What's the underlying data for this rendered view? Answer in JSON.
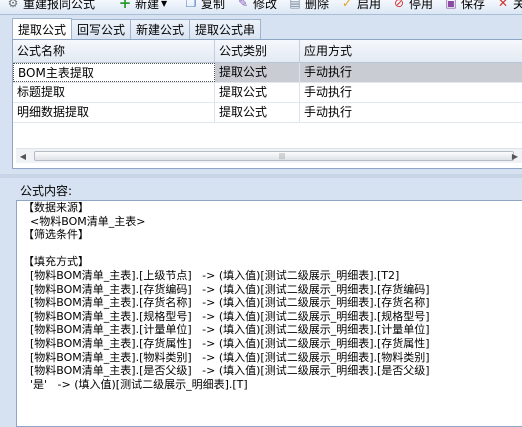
{
  "toolbar": {
    "items": [
      {
        "label": "重建报同公式",
        "icon": "gear-icon"
      },
      {
        "label": "新建",
        "icon": "plus-icon"
      },
      {
        "label": "复制",
        "icon": "copy-icon"
      },
      {
        "label": "修改",
        "icon": "edit-icon"
      },
      {
        "label": "删除",
        "icon": "delete-icon"
      },
      {
        "label": "启用",
        "icon": "check-icon"
      },
      {
        "label": "停用",
        "icon": "stop-icon"
      },
      {
        "label": "保存",
        "icon": "save-icon"
      },
      {
        "label": "关",
        "icon": "close-icon"
      }
    ]
  },
  "tabs": [
    {
      "label": "提取公式",
      "active": true
    },
    {
      "label": "回写公式",
      "active": false
    },
    {
      "label": "新建公式",
      "active": false
    },
    {
      "label": "提取公式串",
      "active": false
    }
  ],
  "grid": {
    "columns": [
      "公式名称",
      "公式类别",
      "应用方式"
    ],
    "rows": [
      {
        "name": "BOM主表提取",
        "category": "提取公式",
        "mode": "手动执行",
        "selected": true
      },
      {
        "name": "标题提取",
        "category": "提取公式",
        "mode": "手动执行",
        "selected": false
      },
      {
        "name": "明细数据提取",
        "category": "提取公式",
        "mode": "手动执行",
        "selected": false
      }
    ]
  },
  "formula": {
    "label": "公式内容:",
    "lines": [
      "【数据来源】",
      "  <物料BOM清单_主表>",
      "【筛选条件】",
      "",
      "【填充方式】",
      "  [物料BOM清单_主表].[上级节点]   -> (填入值)[测试二级展示_明细表].[T2]",
      "  [物料BOM清单_主表].[存货编码]   -> (填入值)[测试二级展示_明细表].[存货编码]",
      "  [物料BOM清单_主表].[存货名称]   -> (填入值)[测试二级展示_明细表].[存货名称]",
      "  [物料BOM清单_主表].[规格型号]   -> (填入值)[测试二级展示_明细表].[规格型号]",
      "  [物料BOM清单_主表].[计量单位]   -> (填入值)[测试二级展示_明细表].[计量单位]",
      "  [物料BOM清单_主表].[存货属性]   -> (填入值)[测试二级展示_明细表].[存货属性]",
      "  [物料BOM清单_主表].[物料类别]   -> (填入值)[测试二级展示_明细表].[物料类别]",
      "  [物料BOM清单_主表].[是否父级]   -> (填入值)[测试二级展示_明细表].[是否父级]",
      "  '是'   -> (填入值)[测试二级展示_明细表].[T]"
    ]
  }
}
